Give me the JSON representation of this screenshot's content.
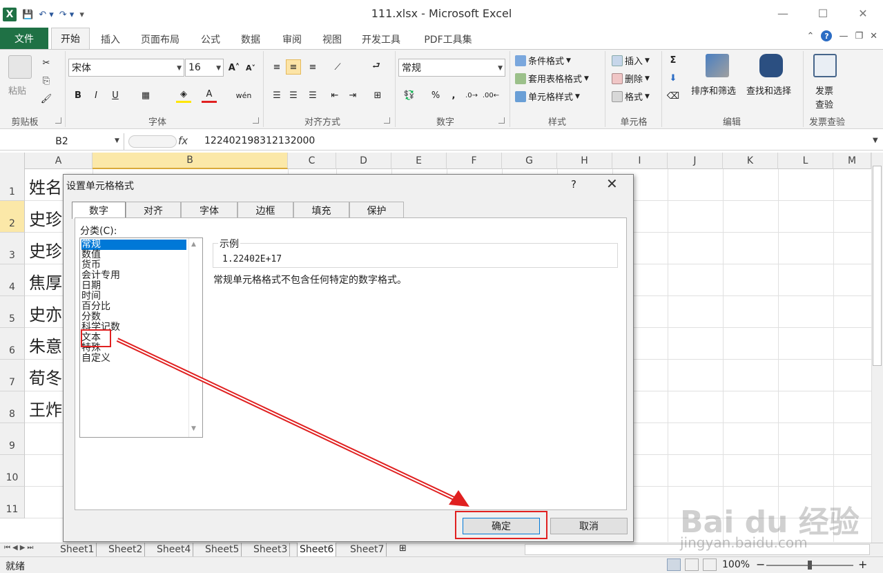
{
  "window": {
    "title": "111.xlsx - Microsoft Excel",
    "logo": "X",
    "minimize": "—",
    "restore": "☐",
    "close": "✕"
  },
  "ribbon_tabs": [
    "文件",
    "开始",
    "插入",
    "页面布局",
    "公式",
    "数据",
    "审阅",
    "视图",
    "开发工具",
    "PDF工具集"
  ],
  "ribbon": {
    "clipboard": {
      "paste": "粘贴",
      "group": "剪贴板"
    },
    "font": {
      "name": "宋体",
      "size": "16",
      "group": "字体"
    },
    "alignment": {
      "group": "对齐方式"
    },
    "number": {
      "format": "常规",
      "percent": "%",
      "comma": ",",
      "group": "数字"
    },
    "styles": {
      "cond": "条件格式",
      "table": "套用表格格式",
      "cell": "单元格样式",
      "group": "样式"
    },
    "cells": {
      "insert": "插入",
      "delete": "删除",
      "format": "格式",
      "group": "单元格"
    },
    "editing": {
      "sort": "排序和筛选",
      "find": "查找和选择",
      "group": "编辑"
    },
    "invoice": {
      "label_1": "发票",
      "label_2": "查验",
      "group": "发票查验"
    }
  },
  "formula_bar": {
    "name_box": "B2",
    "fx": "fx",
    "value": "122402198312132000"
  },
  "grid": {
    "columns": [
      "A",
      "B",
      "C",
      "D",
      "E",
      "F",
      "G",
      "H",
      "I",
      "J",
      "K",
      "L",
      "M"
    ],
    "rows": [
      "1",
      "2",
      "3",
      "4",
      "5",
      "6",
      "7",
      "8",
      "9",
      "10",
      "11"
    ],
    "col_a_cells": [
      "姓名",
      "史珍",
      "史珍",
      "焦厚",
      "史亦",
      "朱意",
      "荀冬",
      "王炸"
    ]
  },
  "sheets": [
    "Sheet1",
    "Sheet2",
    "Sheet4",
    "Sheet5",
    "Sheet3",
    "Sheet6",
    "Sheet7"
  ],
  "active_sheet": "Sheet6",
  "status": {
    "ready": "就绪",
    "zoom": "100%",
    "zoom_out": "−",
    "zoom_in": "+"
  },
  "dialog": {
    "title": "设置单元格格式",
    "help": "?",
    "close": "✕",
    "tabs": [
      "数字",
      "对齐",
      "字体",
      "边框",
      "填充",
      "保护"
    ],
    "category_label": "分类(C):",
    "categories": [
      "常规",
      "数值",
      "货币",
      "会计专用",
      "日期",
      "时间",
      "百分比",
      "分数",
      "科学记数",
      "文本",
      "特殊",
      "自定义"
    ],
    "selected_category": "常规",
    "sample_label": "示例",
    "sample_value": "1.22402E+17",
    "description": "常规单元格格式不包含任何特定的数字格式。",
    "ok": "确定",
    "cancel": "取消"
  },
  "watermark": {
    "brand": "Bai du 经验",
    "url": "jingyan.baidu.com"
  },
  "colors": {
    "excel_green": "#1f7145",
    "selection_blue": "#0078d7",
    "annotation_red": "#e02020"
  }
}
